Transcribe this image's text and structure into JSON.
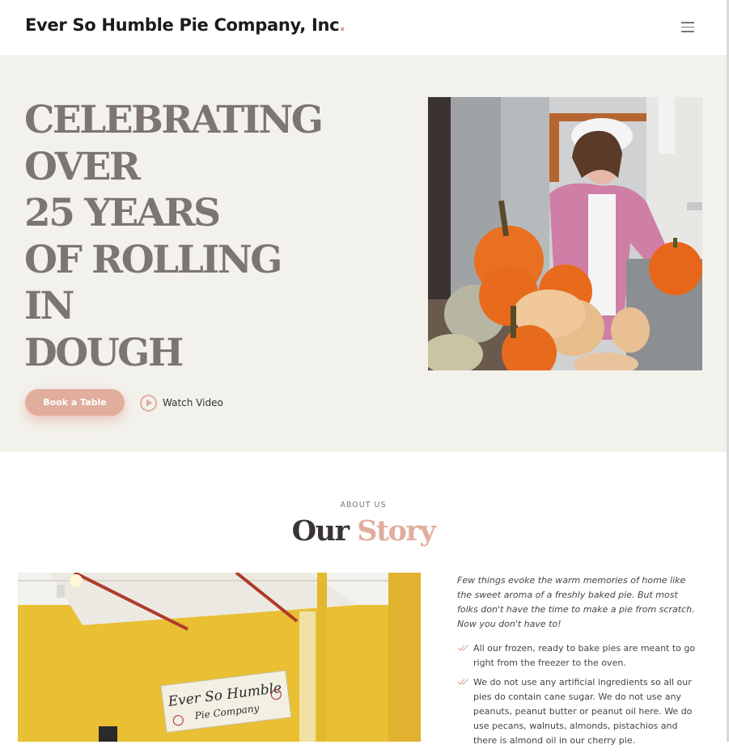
{
  "header": {
    "brand": "Ever So Humble Pie Company, Inc",
    "brand_dot": ".",
    "menu_icon": "hamburger-menu-icon"
  },
  "hero": {
    "heading_lines": [
      "CELEBRATING",
      "OVER",
      "25 YEARS",
      "OF ROLLING",
      "IN",
      "DOUGH"
    ],
    "book_button": "Book a Table",
    "watch_label": "Watch Video",
    "photo": "woman-in-hairnet-holding-pumpkin-with-squash-pile"
  },
  "about": {
    "eyebrow": "ABOUT US",
    "title_main": "Our",
    "title_accent": "Story",
    "photo": "yellow-shop-interior-with-ever-so-humble-pie-company-sign",
    "sign_line1": "Ever So Humble",
    "sign_line2": "Pie Company",
    "intro": "Few things evoke the warm memories of home like the sweet aroma of a freshly baked pie. But most folks don't have the time to make a pie from scratch. Now you don't have to!",
    "points": [
      "All our frozen, ready to bake pies are meant to go right from the freezer to the oven.",
      "We do not use any artificial ingredients so all our pies do contain cane sugar. We do not use any peanuts, peanut butter or peanut oil here. We do use pecans, walnuts, almonds, pistachios and there is almond oil in our cherry pie."
    ]
  },
  "colors": {
    "accent": "#e1ad9d",
    "hero_bg": "#f3f1ec",
    "heading": "#7c7573"
  }
}
